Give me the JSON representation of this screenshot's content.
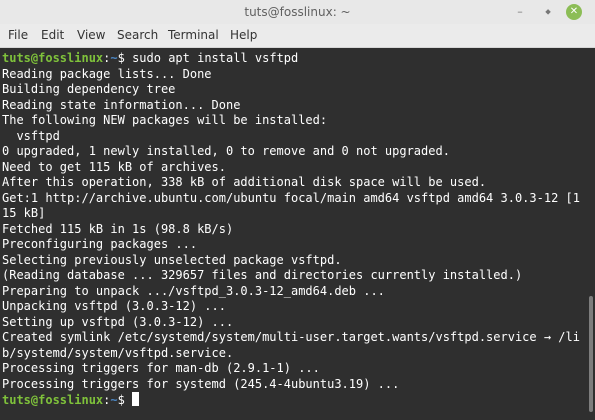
{
  "window": {
    "title": "tuts@fosslinux: ~",
    "controls": {
      "minimize": "–",
      "maximize": "⬥",
      "close": "✕"
    },
    "close_color": "#8cbd56"
  },
  "menubar": {
    "items": [
      {
        "label": "File"
      },
      {
        "label": "Edit"
      },
      {
        "label": "View"
      },
      {
        "label": "Search"
      },
      {
        "label": "Terminal"
      },
      {
        "label": "Help"
      }
    ]
  },
  "terminal": {
    "prompt_user": "tuts@fosslinux",
    "prompt_colon": ":",
    "prompt_path": "~",
    "prompt_symbol": "$ ",
    "command": "sudo apt install vsftpd",
    "output": [
      "Reading package lists... Done",
      "Building dependency tree",
      "Reading state information... Done",
      "The following NEW packages will be installed:",
      "  vsftpd",
      "0 upgraded, 1 newly installed, 0 to remove and 0 not upgraded.",
      "Need to get 115 kB of archives.",
      "After this operation, 338 kB of additional disk space will be used.",
      "Get:1 http://archive.ubuntu.com/ubuntu focal/main amd64 vsftpd amd64 3.0.3-12 [1",
      "15 kB]",
      "Fetched 115 kB in 1s (98.8 kB/s)",
      "Preconfiguring packages ...",
      "Selecting previously unselected package vsftpd.",
      "(Reading database ... 329657 files and directories currently installed.)",
      "Preparing to unpack .../vsftpd_3.0.3-12_amd64.deb ...",
      "Unpacking vsftpd (3.0.3-12) ...",
      "Setting up vsftpd (3.0.3-12) ...",
      "Created symlink /etc/systemd/system/multi-user.target.wants/vsftpd.service → /li",
      "b/systemd/system/vsftpd.service.",
      "Processing triggers for man-db (2.9.1-1) ...",
      "Processing triggers for systemd (245.4-4ubuntu3.19) ..."
    ],
    "colors": {
      "background": "#2f2f2f",
      "text": "#ffffff",
      "user": "#7fc23b",
      "path": "#4b86c2"
    }
  }
}
